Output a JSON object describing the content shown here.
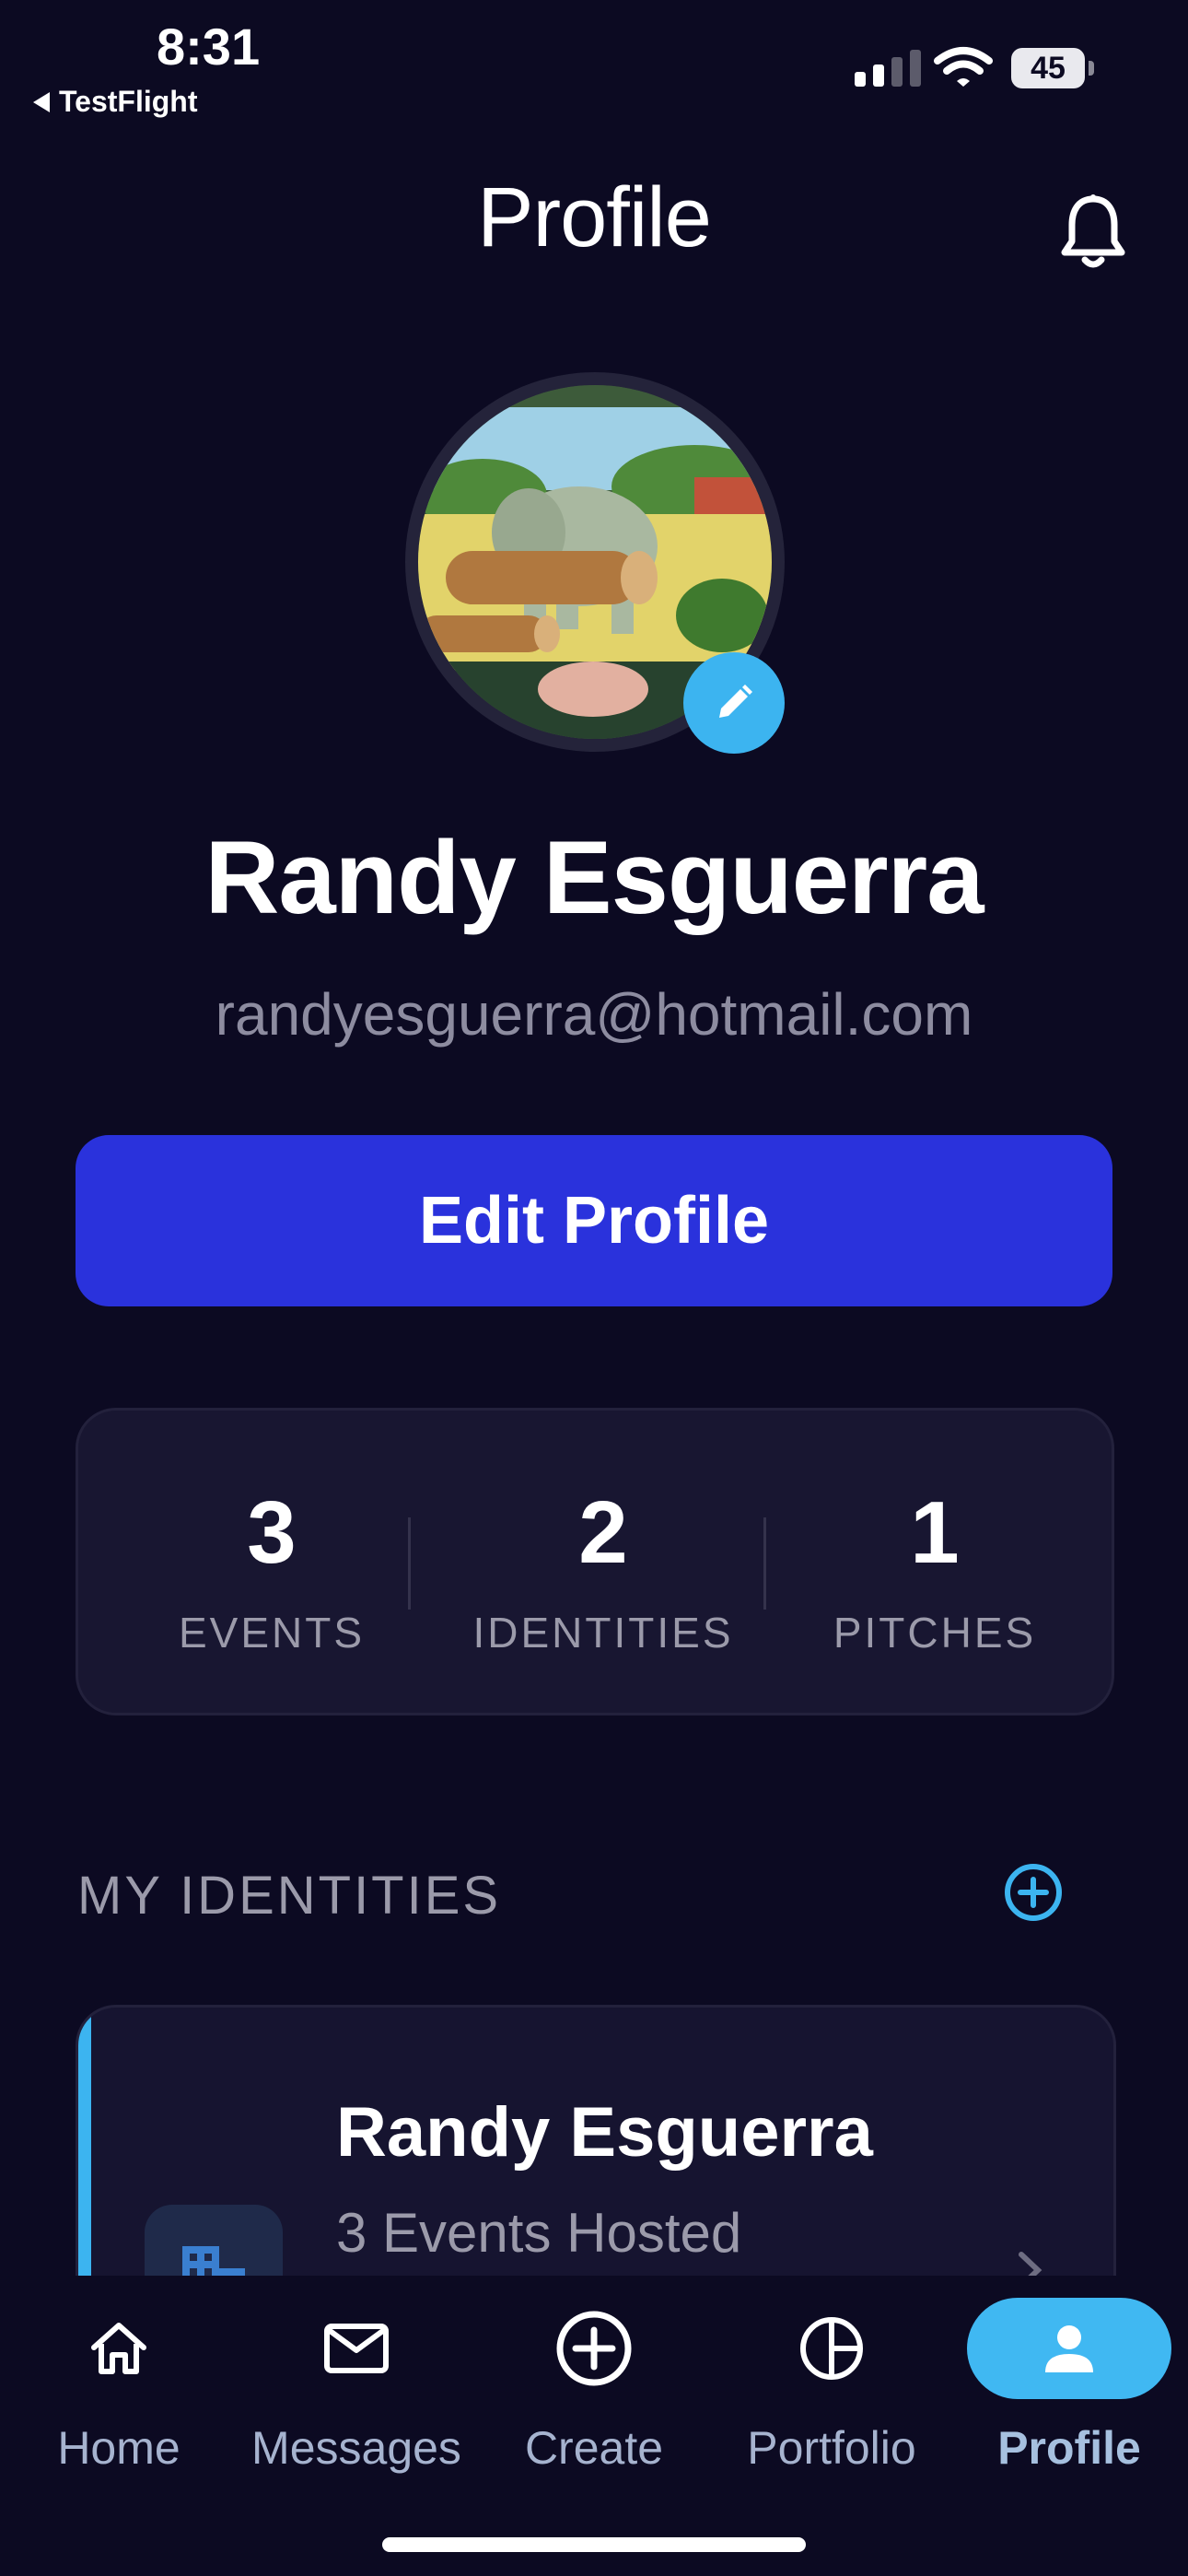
{
  "status_bar": {
    "time": "8:31",
    "back_app": "TestFlight",
    "battery": "45"
  },
  "header": {
    "title": "Profile"
  },
  "profile": {
    "name": "Randy Esguerra",
    "email": "randyesguerra@hotmail.com",
    "edit_button": "Edit Profile"
  },
  "stats": [
    {
      "value": "3",
      "label": "EVENTS"
    },
    {
      "value": "2",
      "label": "IDENTITIES"
    },
    {
      "value": "1",
      "label": "PITCHES"
    }
  ],
  "identities_section": {
    "title": "MY IDENTITIES",
    "cards": [
      {
        "name": "Randy Esguerra",
        "subtitle": "3 Events Hosted"
      }
    ]
  },
  "tabs": [
    {
      "label": "Home",
      "icon": "home-icon"
    },
    {
      "label": "Messages",
      "icon": "mail-icon"
    },
    {
      "label": "Create",
      "icon": "plus-circle-icon"
    },
    {
      "label": "Portfolio",
      "icon": "pie-chart-icon"
    },
    {
      "label": "Profile",
      "icon": "person-icon",
      "active": true
    }
  ],
  "colors": {
    "background": "#0c0a22",
    "primary_button": "#2a32dc",
    "accent": "#3cb4f0",
    "muted_text": "#9b9aaa"
  }
}
